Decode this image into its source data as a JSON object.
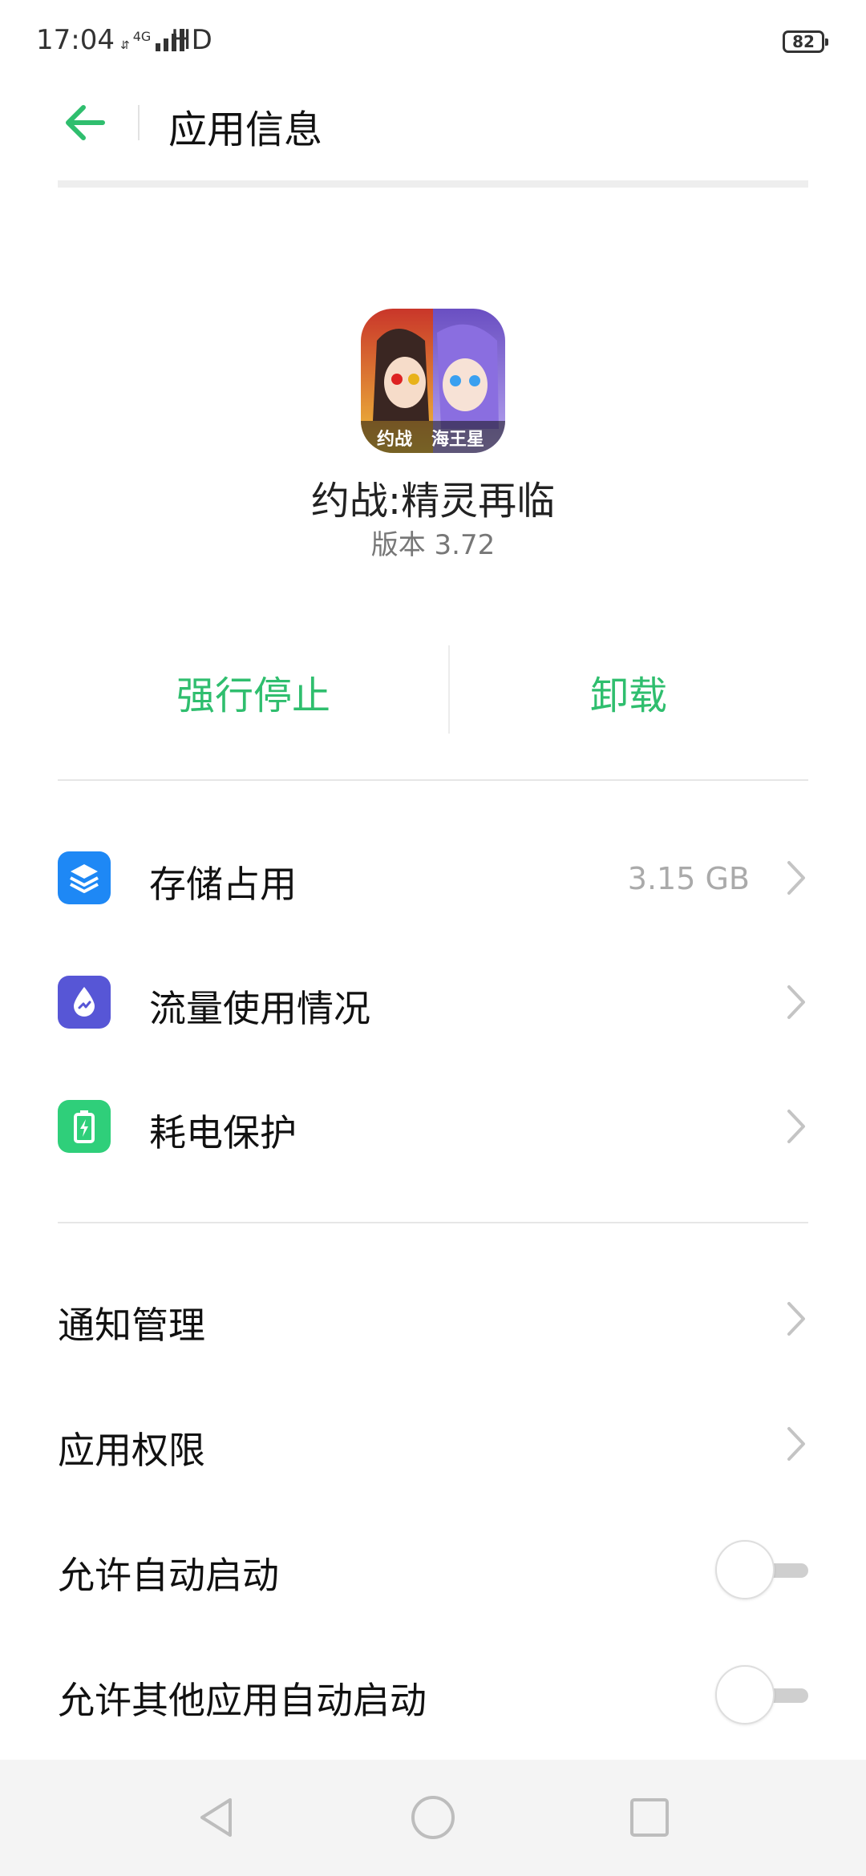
{
  "status_bar": {
    "time": "17:04",
    "network": "4G",
    "hd": "HD",
    "battery": "82"
  },
  "header": {
    "title": "应用信息"
  },
  "app": {
    "name": "约战:精灵再临",
    "version": "版本 3.72",
    "icon_text_left": "约战",
    "icon_text_right": "海王星"
  },
  "actions": {
    "force_stop": "强行停止",
    "uninstall": "卸载"
  },
  "list": [
    {
      "label": "存储占用",
      "value": "3.15 GB",
      "icon": "layers-icon",
      "color": "#1e88f5"
    },
    {
      "label": "流量使用情况",
      "icon": "data-usage-icon",
      "color": "#5756d6"
    },
    {
      "label": "耗电保护",
      "icon": "battery-icon",
      "color": "#2fcf7a"
    }
  ],
  "settings": [
    {
      "label": "通知管理",
      "type": "nav"
    },
    {
      "label": "应用权限",
      "type": "nav"
    },
    {
      "label": "允许自动启动",
      "type": "toggle",
      "on": false
    },
    {
      "label": "允许其他应用自动启动",
      "type": "toggle",
      "on": false
    }
  ],
  "colors": {
    "accent": "#2fbe6e",
    "back_arrow": "#2fbe6e"
  }
}
